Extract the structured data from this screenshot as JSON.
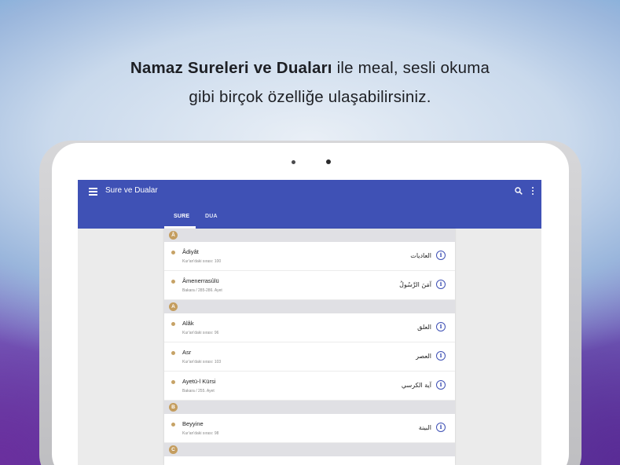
{
  "headline": {
    "bold": "Namaz Sureleri ve Duaları",
    "rest_line1": " ile meal, sesli okuma",
    "line2": "gibi birçok özelliğe ulaşabilirsiniz."
  },
  "appbar": {
    "title": "Sure ve Dualar",
    "menu_icon": "hamburger-menu-icon",
    "search_icon": "search-icon",
    "more_icon": "more-vert-icon",
    "color": "#3f51b5"
  },
  "tabs": [
    {
      "label": "SURE",
      "selected": true
    },
    {
      "label": "DUA",
      "selected": false
    }
  ],
  "sections": [
    {
      "letter": "Â",
      "items": [
        {
          "name": "Âdiyât",
          "sub": "Kur'an'daki sırası: 100",
          "arabic": "العاديات"
        },
        {
          "name": "Âmenerrasûlü",
          "sub": "Bakara / 285-286. Ayet",
          "arabic": "آمَنَ الرَّسُولُ"
        }
      ]
    },
    {
      "letter": "A",
      "items": [
        {
          "name": "Alâk",
          "sub": "Kur'an'daki sırası: 96",
          "arabic": "العلق"
        },
        {
          "name": "Asr",
          "sub": "Kur'an'daki sırası: 103",
          "arabic": "العصر"
        },
        {
          "name": "Ayetü-l Kürsi",
          "sub": "Bakara / 255. Ayet",
          "arabic": "آية الكرسي"
        }
      ]
    },
    {
      "letter": "B",
      "items": [
        {
          "name": "Beyyine",
          "sub": "Kur'an'daki sırası: 98",
          "arabic": "البينة"
        }
      ]
    },
    {
      "letter": "C",
      "items": []
    }
  ],
  "colors": {
    "badge": "#c49d5f",
    "info": "#3f51b5"
  }
}
